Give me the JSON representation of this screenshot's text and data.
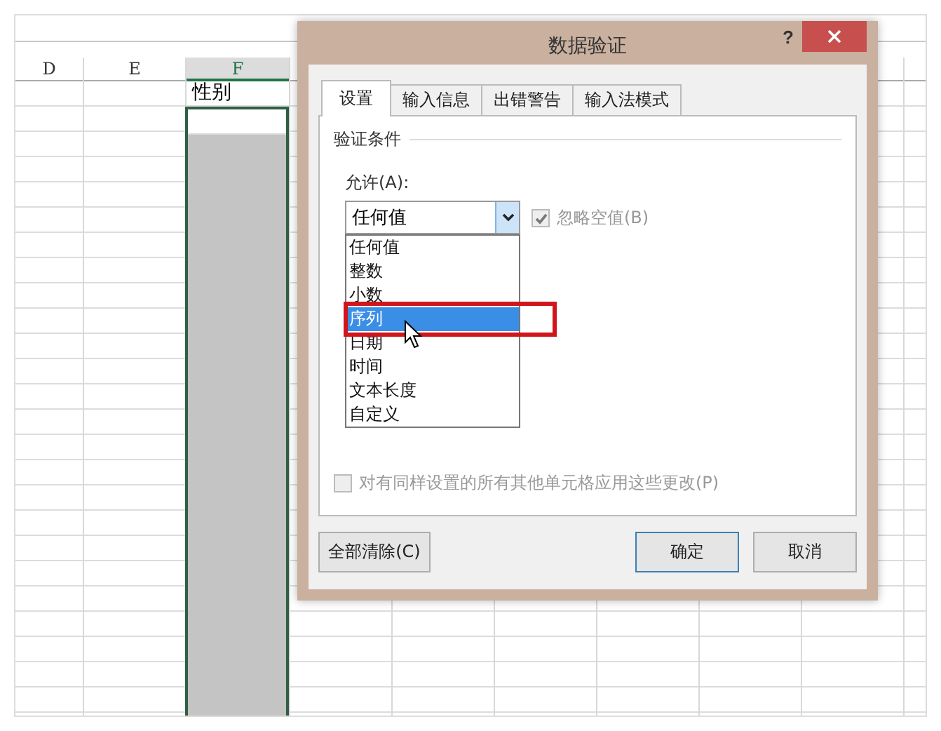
{
  "sheet": {
    "columns": [
      {
        "label": "D",
        "selected": false
      },
      {
        "label": "E",
        "selected": false
      },
      {
        "label": "F",
        "selected": true,
        "cell_text": "性别"
      }
    ]
  },
  "dialog": {
    "title": "数据验证",
    "help": "?",
    "tabs": [
      {
        "label": "设置",
        "selected": true
      },
      {
        "label": "输入信息",
        "selected": false
      },
      {
        "label": "出错警告",
        "selected": false
      },
      {
        "label": "输入法模式",
        "selected": false
      }
    ],
    "section_title": "验证条件",
    "allow": {
      "label": "允许(A):",
      "value": "任何值",
      "expanded": true,
      "options": [
        {
          "label": "任何值",
          "highlighted": false
        },
        {
          "label": "整数",
          "highlighted": false
        },
        {
          "label": "小数",
          "highlighted": false
        },
        {
          "label": "序列",
          "highlighted": true
        },
        {
          "label": "日期",
          "highlighted": false
        },
        {
          "label": "时间",
          "highlighted": false
        },
        {
          "label": "文本长度",
          "highlighted": false
        },
        {
          "label": "自定义",
          "highlighted": false
        }
      ]
    },
    "ignore_blank": {
      "label": "忽略空值(B)",
      "checked": true,
      "disabled": true
    },
    "apply_all": {
      "label": "对有同样设置的所有其他单元格应用这些更改(P)",
      "checked": false,
      "disabled": true
    },
    "buttons": [
      {
        "label": "全部清除(C)",
        "kind": "clear"
      },
      {
        "label": "确定",
        "kind": "default"
      },
      {
        "label": "取消",
        "kind": "normal"
      }
    ]
  }
}
